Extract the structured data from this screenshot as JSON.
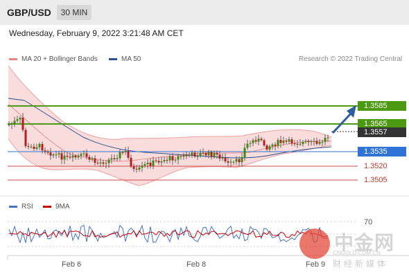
{
  "header": {
    "symbol": "GBP/USD",
    "timeframe": "30 MIN"
  },
  "timestamp": "Wednesday, February 9, 2022 3:21:48 AM CET",
  "legend": {
    "bb_label": "MA 20 + Bollinger Bands",
    "bb_color": "#f08080",
    "ma50_label": "MA 50",
    "ma50_color": "#2b4f8c"
  },
  "credit": "Research © 2022 Trading Central",
  "levels": {
    "resistance_2": "1.3585",
    "resistance_1": "1.3565",
    "last_price": "1.3557",
    "pivot": "1.3535",
    "support_1": "1.3520",
    "support_2": "1.3505"
  },
  "colors": {
    "resistance": "#4c9a12",
    "pivot": "#2f73d6",
    "support": "#d04848",
    "price_tag": "#333333",
    "arrow": "#2b5f9e"
  },
  "rsi": {
    "label": "RSI",
    "label_color": "#4472c4",
    "ma_label": "9MA",
    "ma_color": "#cc0000",
    "level": "70"
  },
  "x_axis": [
    "Feb 6",
    "Feb 8",
    "Feb 9"
  ],
  "watermark": {
    "main": "中金网",
    "site": "CNGOLD.COM.CN",
    "sub": "财经新媒体"
  }
}
